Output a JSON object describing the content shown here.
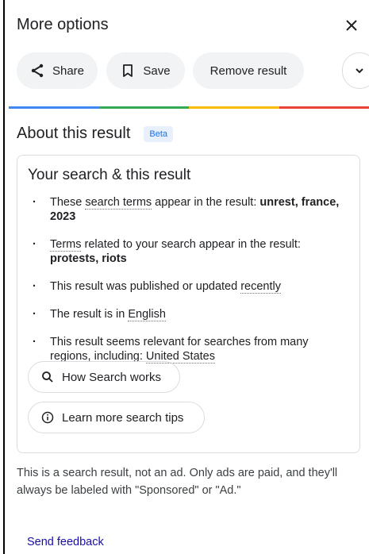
{
  "header": {
    "title": "More options",
    "close_icon": "close-icon"
  },
  "actions": {
    "share": "Share",
    "save": "Save",
    "remove": "Remove result",
    "more_icon": "chevron-down-icon"
  },
  "colors": {
    "blue": "#4285f4",
    "green": "#34a853",
    "yellow": "#fbbc04",
    "red": "#ea4335",
    "link": "#1a0dab"
  },
  "about": {
    "title": "About this result",
    "badge": "Beta"
  },
  "card": {
    "title": "Your search & this result",
    "items": [
      {
        "pre": "These ",
        "link": "search terms",
        "mid": " appear in the result: ",
        "bold": "unrest, france, 2023"
      },
      {
        "link": "Terms",
        "mid": " related to your search appear in the result: ",
        "bold": "protests, riots"
      },
      {
        "pre": "This result was published or updated ",
        "link": "recently"
      },
      {
        "pre": "The result is in ",
        "link": "English"
      },
      {
        "pre": "This result seems relevant for searches from many regions, including: ",
        "link": "United States"
      }
    ],
    "how_search_works": "How Search works",
    "learn_more": "Learn more search tips"
  },
  "note": "This is a search result, not an ad. Only ads are paid, and they'll always be labeled with \"Sponsored\" or \"Ad.\"",
  "feedback": "Send feedback"
}
